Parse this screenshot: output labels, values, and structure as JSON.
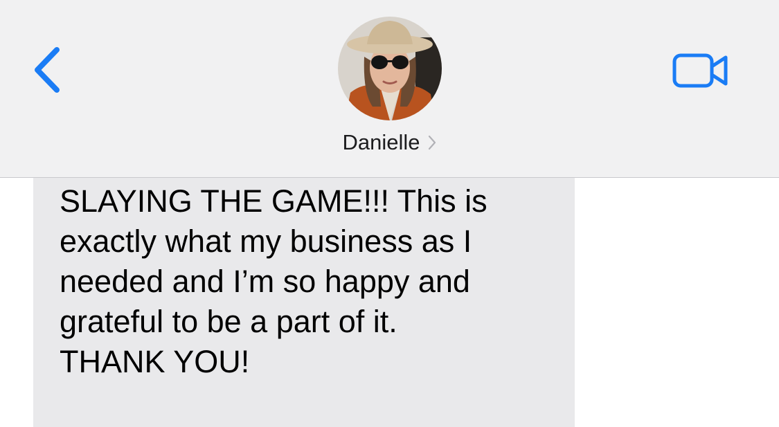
{
  "header": {
    "contact_name": "Danielle",
    "back_icon": "chevron-left-icon",
    "video_icon": "video-camera-icon",
    "accent_color": "#1a7cf5"
  },
  "message": {
    "lines": [
      "SLAYING THE GAME!!! This is",
      "exactly what my business as I",
      "needed and I’m so happy and",
      "grateful to be a part of it.",
      "THANK YOU!"
    ],
    "bubble_color": "#e9e9eb"
  }
}
